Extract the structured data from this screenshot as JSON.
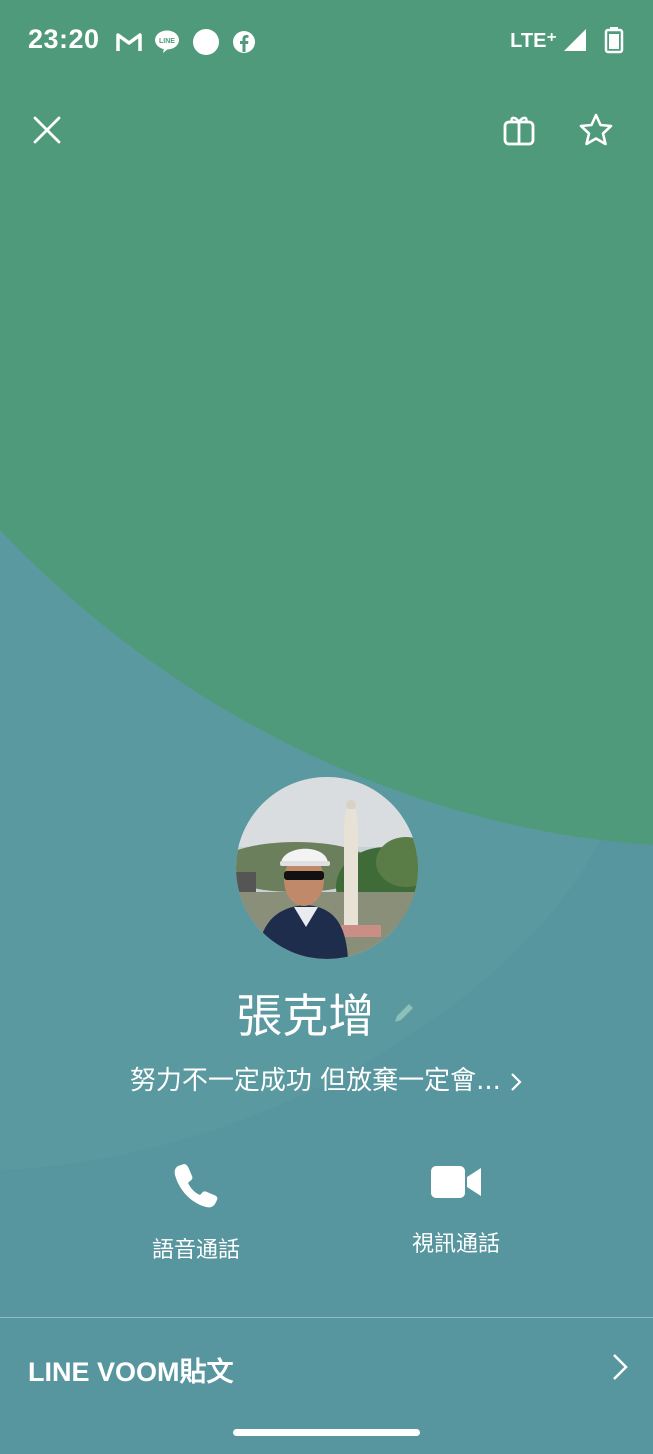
{
  "status_bar": {
    "time": "23:20",
    "left_icons": [
      "gmail-icon",
      "line-icon",
      "circle-icon",
      "facebook-icon"
    ],
    "network": "LTE⁺",
    "right_icons": [
      "signal-icon",
      "battery-icon"
    ]
  },
  "header": {
    "close_icon": "close-icon",
    "right_icons": [
      "keep-icon",
      "star-icon"
    ]
  },
  "profile": {
    "name": "張克增",
    "status_message": "努力不一定成功 但放棄一定會...",
    "avatar": "profile-photo"
  },
  "actions": [
    {
      "label": "語音通話",
      "icon": "phone-icon"
    },
    {
      "label": "視訊通話",
      "icon": "video-camera-icon"
    }
  ],
  "voom": {
    "label": "LINE VOOM貼文"
  },
  "colors": {
    "top_green": "#4f9a7b",
    "bottom_teal": "#5a99a0",
    "text": "#ffffff"
  }
}
